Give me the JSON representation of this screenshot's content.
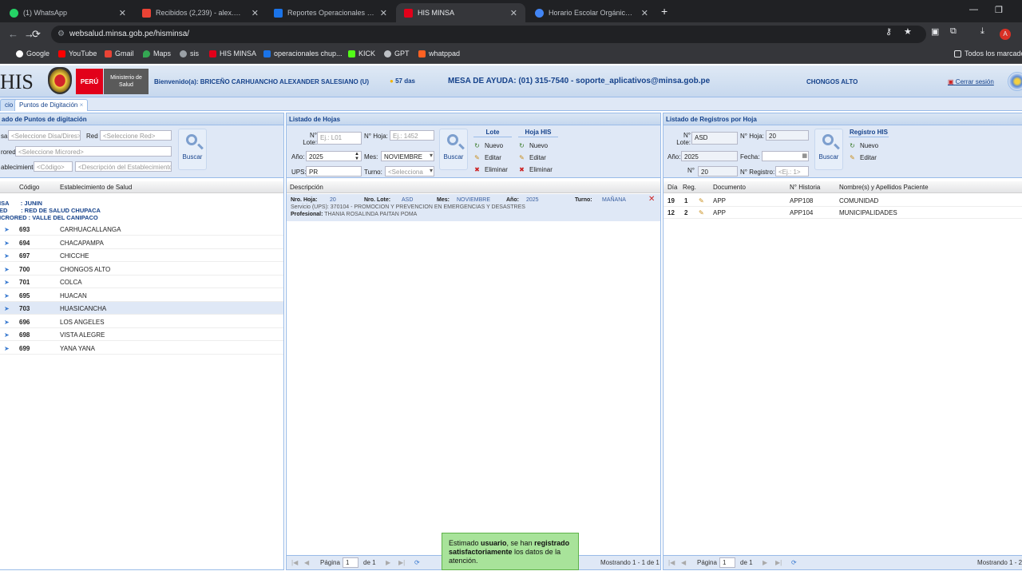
{
  "browser": {
    "tabs": [
      {
        "label": "(1) WhatsApp",
        "color": "#25d366",
        "active": false
      },
      {
        "label": "Recibidos (2,239) - alex.majre@",
        "color": "#ea4335",
        "active": false
      },
      {
        "label": "Reportes Operacionales - Red C",
        "color": "#1a73e8",
        "active": false
      },
      {
        "label": "HIS MINSA",
        "color": "#e2001a",
        "active": true
      },
      {
        "label": "Horario Escolar Orgánico Ilustr",
        "color": "#4285f4",
        "active": false
      }
    ],
    "url": "websalud.minsa.gob.pe/hisminsa/",
    "bookmarks": [
      "Google",
      "YouTube",
      "Gmail",
      "Maps",
      "sis",
      "HIS MINSA",
      "operacionales chup...",
      "KICK",
      "GPT",
      "whatppad"
    ],
    "bookmarks_all": "Todos los marcadores"
  },
  "header": {
    "logo": "HIS",
    "peru": "PERÚ",
    "ministerio": "Ministerio de Salud",
    "welcome": "Bienvenido(a): BRICEÑO CARHUANCHO ALEXANDER SALESIANO (U)",
    "days": "57 das",
    "help": "MESA DE AYUDA: (01) 315-7540 - soporte_aplicativos@minsa.gob.pe",
    "establishment": "CHONGOS ALTO",
    "logout": "Cerrar sesión"
  },
  "apptabs": [
    "cio",
    "Puntos de Digitación"
  ],
  "left": {
    "title": "ado de Puntos de digitación",
    "labels": {
      "disa": "sa",
      "red": "Red",
      "microred": "rored",
      "estab": "ablecimiento:"
    },
    "placeholders": {
      "disa": "<Seleccione Disa/Dires>",
      "red": "<Seleccione Red>",
      "microred": "<Seleccione Microred>",
      "codigo": "<Código>",
      "desc": "<Descripción del Establecimiento>"
    },
    "search": "Buscar",
    "cols": [
      "Código",
      "Establecimiento de Salud"
    ],
    "group": [
      "ISA       : JUNIN",
      "ED        : RED DE SALUD CHUPACA",
      "ICRORED : VALLE DEL CANIPACO"
    ],
    "rows": [
      {
        "code": "693",
        "name": "CARHUACALLANGA"
      },
      {
        "code": "694",
        "name": "CHACAPAMPA"
      },
      {
        "code": "697",
        "name": "CHICCHE"
      },
      {
        "code": "700",
        "name": "CHONGOS ALTO"
      },
      {
        "code": "701",
        "name": "COLCA"
      },
      {
        "code": "695",
        "name": "HUACAN"
      },
      {
        "code": "703",
        "name": "HUASICANCHA"
      },
      {
        "code": "696",
        "name": "LOS ANGELES"
      },
      {
        "code": "698",
        "name": "VISTA ALEGRE"
      },
      {
        "code": "699",
        "name": "YANA YANA"
      }
    ]
  },
  "middle": {
    "title": "Listado de Hojas",
    "labels": {
      "lote": "N° Lote:",
      "hoja": "N° Hoja:",
      "anio": "Año:",
      "mes": "Mes:",
      "ups": "UPS:",
      "turno": "Turno:"
    },
    "values": {
      "lote_ph": "Ej.: L01",
      "hoja_ph": "Ej.: 1452",
      "anio": "2025",
      "mes": "NOVIEMBRE",
      "ups": "PR",
      "turno_ph": "<Selecciona"
    },
    "search": "Buscar",
    "lote_group": {
      "title": "Lote",
      "items": [
        "Nuevo",
        "Editar",
        "Eliminar"
      ]
    },
    "hoja_group": {
      "title": "Hoja HIS",
      "items": [
        "Nuevo",
        "Editar",
        "Eliminar"
      ]
    },
    "col": "Descripción",
    "record": {
      "l_hoja": "Nro. Hoja:",
      "v_hoja": "20",
      "l_lote": "Nro. Lote:",
      "v_lote": "ASD",
      "l_mes": "Mes:",
      "v_mes": "NOVIEMBRE",
      "l_anio": "Año:",
      "v_anio": "2025",
      "l_turno": "Turno:",
      "v_turno": "MAÑANA",
      "servicio": "Servicio (UPS): 370104 - PROMOCION Y PREVENCION EN EMERGENCIAS Y DESASTRES",
      "l_prof": "Profesional:",
      "v_prof": "THANIA ROSALINDA PAITAN POMA"
    },
    "pager": {
      "page": "Página",
      "num": "1",
      "of": "de 1",
      "showing": "Mostrando 1 - 1 de 1"
    }
  },
  "right": {
    "title": "Listado de Registros por Hoja",
    "labels": {
      "lote": "N° Lote:",
      "hoja": "N° Hoja:",
      "anio": "Año:",
      "fecha": "Fecha:",
      "n": "N°",
      "reg": "N° Registro:"
    },
    "values": {
      "lote": "ASD",
      "hoja": "20",
      "anio": "2025",
      "n": "20",
      "reg_ph": "<Ej.: 1>"
    },
    "search": "Buscar",
    "reg_group": {
      "title": "Registro HIS",
      "items": [
        "Nuevo",
        "Editar"
      ]
    },
    "cols": [
      "Día",
      "Reg.",
      "Documento",
      "N° Historia",
      "Nombre(s) y Apellidos Paciente"
    ],
    "rows": [
      {
        "dia": "19",
        "reg": "1",
        "doc": "APP",
        "hist": "APP108",
        "name": "COMUNIDAD"
      },
      {
        "dia": "12",
        "reg": "2",
        "doc": "APP",
        "hist": "APP104",
        "name": "MUNICIPALIDADES"
      }
    ],
    "pager": {
      "page": "Página",
      "num": "1",
      "of": "de 1",
      "showing": "Mostrando 1 - 2"
    }
  },
  "toast": {
    "p1": "Estimado ",
    "b1": "usuario",
    "p2": ", se han ",
    "b2": "registrado satisfactoriamente",
    "p3": " los datos de la atención."
  }
}
